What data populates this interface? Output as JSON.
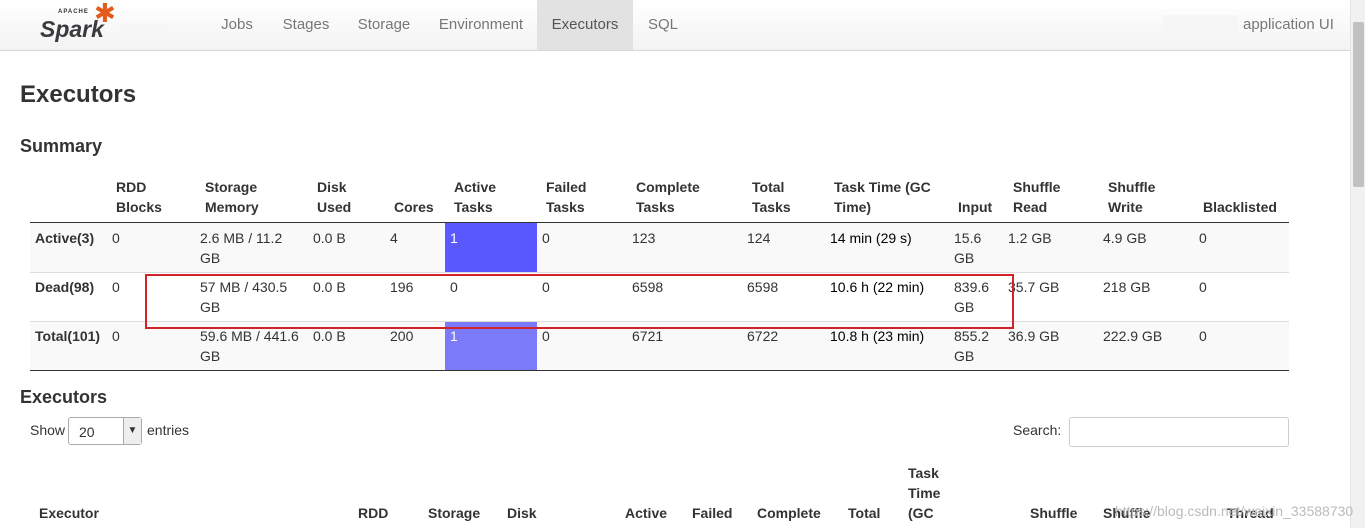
{
  "nav": {
    "logo_top": "APACHE",
    "logo_main": "Spark",
    "items": [
      {
        "label": "Jobs"
      },
      {
        "label": "Stages"
      },
      {
        "label": "Storage"
      },
      {
        "label": "Environment"
      },
      {
        "label": "Executors"
      },
      {
        "label": "SQL"
      }
    ],
    "active": "Executors",
    "app_name": "application UI"
  },
  "page": {
    "title": "Executors",
    "summary_heading": "Summary",
    "executors_heading": "Executors"
  },
  "summary": {
    "headers": [
      {
        "l1": "RDD",
        "l2": "Blocks"
      },
      {
        "l1": "Storage",
        "l2": "Memory"
      },
      {
        "l1": "Disk",
        "l2": "Used"
      },
      {
        "l1": "",
        "l2": "Cores"
      },
      {
        "l1": "Active",
        "l2": "Tasks"
      },
      {
        "l1": "Failed",
        "l2": "Tasks"
      },
      {
        "l1": "Complete",
        "l2": "Tasks"
      },
      {
        "l1": "Total",
        "l2": "Tasks"
      },
      {
        "l1": "Task Time (GC",
        "l2": "Time)"
      },
      {
        "l1": "",
        "l2": "Input"
      },
      {
        "l1": "Shuffle",
        "l2": "Read"
      },
      {
        "l1": "Shuffle",
        "l2": "Write"
      },
      {
        "l1": "",
        "l2": "Blacklisted"
      }
    ],
    "rows": [
      {
        "label": "Active(3)",
        "rdd": "0",
        "mem1": "2.6 MB / 11.2",
        "mem2": "GB",
        "disk": "0.0 B",
        "cores": "4",
        "active": "1",
        "failed": "0",
        "complete": "123",
        "total": "124",
        "tasktime": "14 min (29 s)",
        "input1": "15.6",
        "input2": "GB",
        "shuffle_read": "1.2 GB",
        "shuffle_write": "4.9 GB",
        "blacklisted": "0"
      },
      {
        "label": "Dead(98)",
        "rdd": "0",
        "mem1": "57 MB / 430.5",
        "mem2": "GB",
        "disk": "0.0 B",
        "cores": "196",
        "active": "0",
        "failed": "0",
        "complete": "6598",
        "total": "6598",
        "tasktime": "10.6 h (22 min)",
        "input1": "839.6",
        "input2": "GB",
        "shuffle_read": "35.7 GB",
        "shuffle_write": "218 GB",
        "blacklisted": "0"
      },
      {
        "label": "Total(101)",
        "rdd": "0",
        "mem1": "59.6 MB / 441.6",
        "mem2": "GB",
        "disk": "0.0 B",
        "cores": "200",
        "active": "1",
        "failed": "0",
        "complete": "6721",
        "total": "6722",
        "tasktime": "10.8 h (23 min)",
        "input1": "855.2",
        "input2": "GB",
        "shuffle_read": "36.9 GB",
        "shuffle_write": "222.9 GB",
        "blacklisted": "0"
      }
    ],
    "colors": {
      "active_bar": "#5959ff",
      "active_bar_total": "#7b7bf9",
      "highlight": "#d0242a"
    }
  },
  "controls": {
    "show_label": "Show",
    "page_size": "20",
    "entries_label": "entries",
    "search_label": "Search:",
    "search_value": ""
  },
  "executors_table": {
    "headers": [
      {
        "lines": [
          "Executor"
        ]
      },
      {
        "lines": [
          "RDD"
        ]
      },
      {
        "lines": [
          "Storage"
        ]
      },
      {
        "lines": [
          "Disk"
        ]
      },
      {
        "lines": [
          "Active"
        ]
      },
      {
        "lines": [
          "Failed"
        ]
      },
      {
        "lines": [
          "Complete"
        ]
      },
      {
        "lines": [
          "Total"
        ]
      },
      {
        "lines": [
          "Task",
          "Time",
          "(GC"
        ]
      },
      {
        "lines": [
          "Shuffle"
        ]
      },
      {
        "lines": [
          "Shuffle"
        ]
      },
      {
        "lines": [
          "Thread"
        ]
      }
    ]
  },
  "watermark": "https://blog.csdn.net/weixin_33588730"
}
